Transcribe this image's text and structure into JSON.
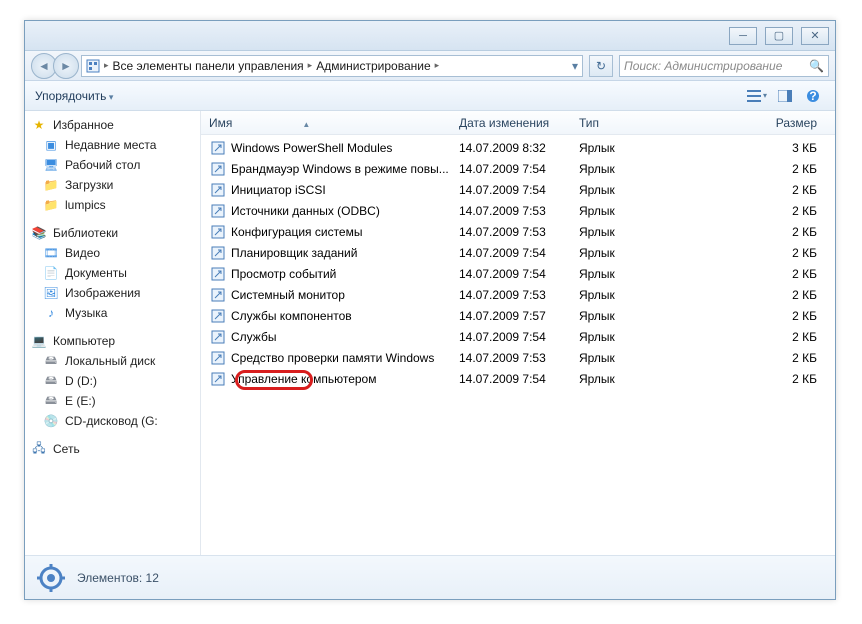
{
  "breadcrumb": {
    "part1": "Все элементы панели управления",
    "part2": "Администрирование"
  },
  "search": {
    "placeholder": "Поиск: Администрирование"
  },
  "toolbar": {
    "organize": "Упорядочить"
  },
  "nav": {
    "favorites": {
      "label": "Избранное",
      "items": [
        "Недавние места",
        "Рабочий стол",
        "Загрузки",
        "lumpics"
      ]
    },
    "libraries": {
      "label": "Библиотеки",
      "items": [
        "Видео",
        "Документы",
        "Изображения",
        "Музыка"
      ]
    },
    "computer": {
      "label": "Компьютер",
      "items": [
        "Локальный диск",
        "D (D:)",
        "E (E:)",
        "CD-дисковод (G:"
      ]
    },
    "network": {
      "label": "Сеть"
    }
  },
  "columns": {
    "name": "Имя",
    "date": "Дата изменения",
    "type": "Тип",
    "size": "Размер"
  },
  "items": [
    {
      "name": "Windows PowerShell Modules",
      "date": "14.07.2009 8:32",
      "type": "Ярлык",
      "size": "3 КБ"
    },
    {
      "name": "Брандмауэр Windows в режиме повы...",
      "date": "14.07.2009 7:54",
      "type": "Ярлык",
      "size": "2 КБ"
    },
    {
      "name": "Инициатор iSCSI",
      "date": "14.07.2009 7:54",
      "type": "Ярлык",
      "size": "2 КБ"
    },
    {
      "name": "Источники данных (ODBC)",
      "date": "14.07.2009 7:53",
      "type": "Ярлык",
      "size": "2 КБ"
    },
    {
      "name": "Конфигурация системы",
      "date": "14.07.2009 7:53",
      "type": "Ярлык",
      "size": "2 КБ"
    },
    {
      "name": "Планировщик заданий",
      "date": "14.07.2009 7:54",
      "type": "Ярлык",
      "size": "2 КБ"
    },
    {
      "name": "Просмотр событий",
      "date": "14.07.2009 7:54",
      "type": "Ярлык",
      "size": "2 КБ"
    },
    {
      "name": "Системный монитор",
      "date": "14.07.2009 7:53",
      "type": "Ярлык",
      "size": "2 КБ"
    },
    {
      "name": "Службы компонентов",
      "date": "14.07.2009 7:57",
      "type": "Ярлык",
      "size": "2 КБ"
    },
    {
      "name": "Службы",
      "date": "14.07.2009 7:54",
      "type": "Ярлык",
      "size": "2 КБ",
      "highlight": true
    },
    {
      "name": "Средство проверки памяти Windows",
      "date": "14.07.2009 7:53",
      "type": "Ярлык",
      "size": "2 КБ"
    },
    {
      "name": "Управление компьютером",
      "date": "14.07.2009 7:54",
      "type": "Ярлык",
      "size": "2 КБ"
    }
  ],
  "status": {
    "text": "Элементов: 12"
  }
}
